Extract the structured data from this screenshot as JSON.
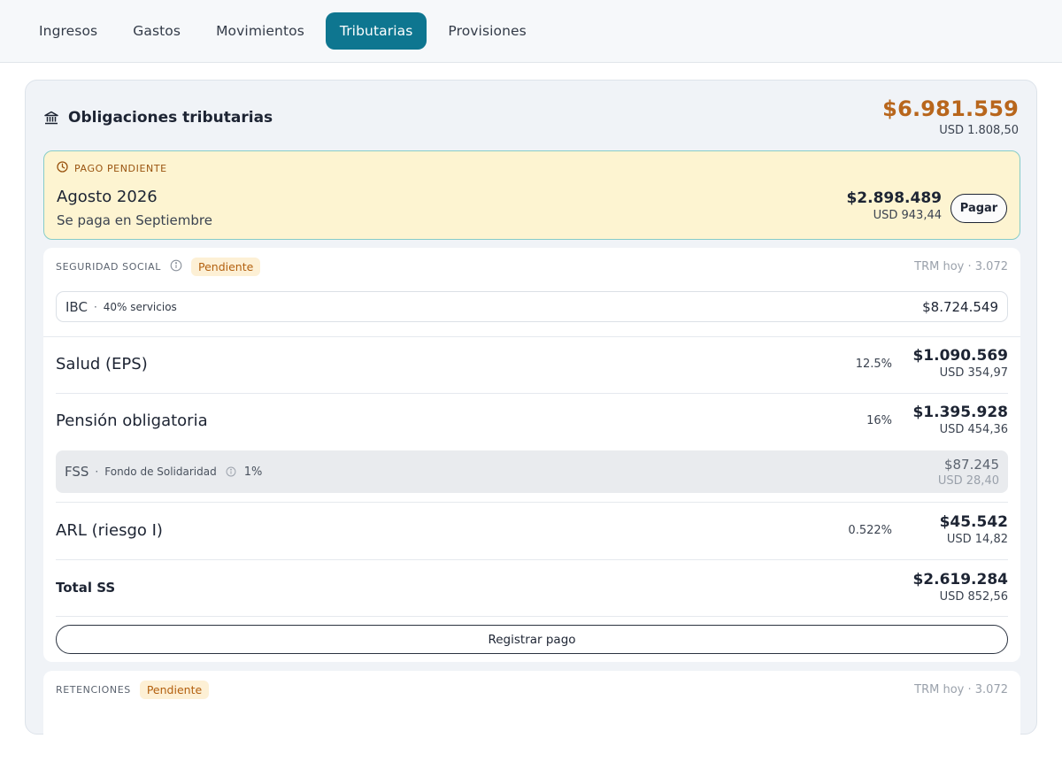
{
  "tabs": [
    {
      "label": "Ingresos",
      "active": false
    },
    {
      "label": "Gastos",
      "active": false
    },
    {
      "label": "Movimientos",
      "active": false
    },
    {
      "label": "Tributarias",
      "active": true
    },
    {
      "label": "Provisiones",
      "active": false
    }
  ],
  "obligations": {
    "title": "Obligaciones tributarias",
    "icon": "bank-icon",
    "total": "$6.981.559",
    "total_usd": "USD 1.808,50",
    "accent_color": "#b8661c"
  },
  "pending_payment": {
    "label": "PAGO PENDIENTE",
    "icon": "clock-icon",
    "month": "Agosto 2026",
    "due_note": "Se paga en Septiembre",
    "amount": "$2.898.489",
    "amount_usd": "USD 943,44",
    "pay_label": "Pagar"
  },
  "social_security": {
    "section_label": "SEGURIDAD SOCIAL",
    "status": "Pendiente",
    "trm": "TRM hoy · 3.072",
    "ibc": {
      "key": "IBC",
      "sep": "·",
      "desc": "40% servicios",
      "value": "$8.724.549"
    },
    "rows": [
      {
        "name": "Salud (EPS)",
        "pct": "12.5%",
        "amount": "$1.090.569",
        "usd": "USD 354,97"
      },
      {
        "name": "Pensión obligatoria",
        "pct": "16%",
        "amount": "$1.395.928",
        "usd": "USD 454,36"
      },
      {
        "name": "ARL (riesgo I)",
        "pct": "0.522%",
        "amount": "$45.542",
        "usd": "USD 14,82"
      }
    ],
    "fss": {
      "key": "FSS",
      "sep": "·",
      "desc": "Fondo de Solidaridad",
      "pct": "1%",
      "amount": "$87.245",
      "usd": "USD 28,40"
    },
    "total": {
      "name": "Total SS",
      "amount": "$2.619.284",
      "usd": "USD 852,56"
    },
    "register_label": "Registrar pago"
  },
  "retentions": {
    "section_label": "RETENCIONES",
    "status": "Pendiente",
    "trm": "TRM hoy · 3.072"
  },
  "colors": {
    "primary": "#0e7690",
    "pending_bg": "#fdf4d1",
    "pending_border": "#86ccc8",
    "badge_bg": "#fdf0d5",
    "badge_text": "#b3600f"
  }
}
